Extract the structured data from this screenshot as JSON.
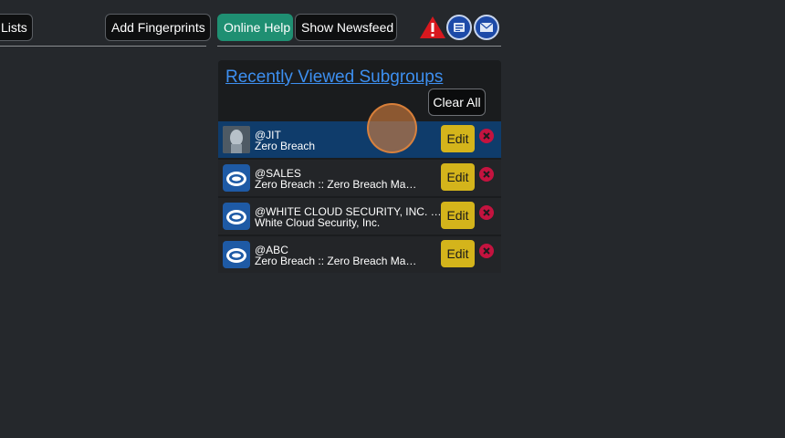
{
  "toolbar": {
    "lists_label": "Lists",
    "add_fingerprints_label": "Add Fingerprints",
    "online_help_label": "Online Help",
    "show_newsfeed_label": "Show Newsfeed"
  },
  "header_icons": [
    "alert-icon",
    "document-icon",
    "mail-icon"
  ],
  "panel": {
    "title": "Recently Viewed Subgroups",
    "clear_all_label": "Clear All",
    "edit_label": "Edit",
    "rows": [
      {
        "name": "@JIT",
        "sub": "Zero Breach",
        "avatar": "photo",
        "active": true
      },
      {
        "name": "@SALES",
        "sub": "Zero Breach :: Zero Breach Management",
        "avatar": "logo",
        "active": false
      },
      {
        "name": "@WHITE CLOUD SECURITY, INC. DEMO",
        "sub": "White Cloud Security, Inc.",
        "avatar": "logo",
        "active": false
      },
      {
        "name": "@ABC",
        "sub": "Zero Breach :: Zero Breach Management",
        "avatar": "logo",
        "active": false
      }
    ]
  },
  "colors": {
    "background": "#25282c",
    "help_button": "#1f8f72",
    "edit_button": "#d4b41b",
    "remove_button": "#c4133f",
    "link": "#3d8ff0",
    "active_row": "#0f3c6b"
  }
}
